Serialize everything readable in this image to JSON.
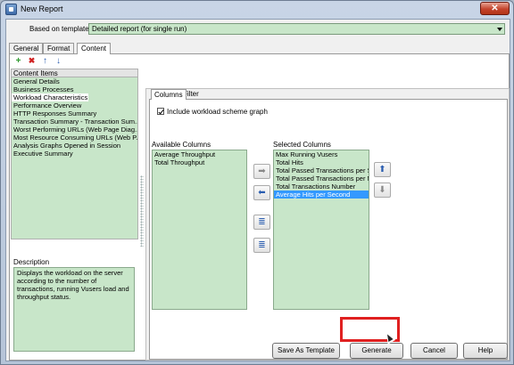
{
  "window": {
    "title": "New Report",
    "close_label": "✕"
  },
  "template": {
    "label": "Based on template",
    "value": "Detailed report (for single run)"
  },
  "tabs": [
    {
      "label": "General"
    },
    {
      "label": "Format"
    },
    {
      "label": "Content"
    }
  ],
  "toolbar": {
    "add": "+",
    "delete": "✖",
    "up": "↑",
    "down": "↓"
  },
  "content_items": {
    "header": "Content Items",
    "items": [
      "General Details",
      "Business Processes",
      "Workload Characteristics",
      "Performance Overview",
      "HTTP Responses Summary",
      "Transaction Summary - Transaction Sum...",
      "Worst Performing URLs (Web Page Diag...",
      "Most Resource Consuming URLs (Web P...",
      "Analysis Graphs Opened in Session",
      "Executive Summary"
    ],
    "selected_index": 2
  },
  "description": {
    "header": "Description",
    "text": "Displays the workload on the server according to the number of transactions, running Vusers load and throughput status."
  },
  "subtabs": [
    {
      "label": "Columns"
    },
    {
      "label": "Filter"
    }
  ],
  "columns": {
    "include_label": "Include workload scheme graph",
    "available_label": "Available Columns",
    "selected_label": "Selected Columns",
    "available": [
      "Average Throughput",
      "Total Throughput"
    ],
    "selected": [
      "Max Running Vusers",
      "Total Hits",
      "Total Passed Transactions per Se",
      "Total Passed Transactions per Mi",
      "Total Transactions Number",
      "Average Hits per Second"
    ],
    "selected_index": 5
  },
  "buttons": {
    "save_template": "Save As Template",
    "generate": "Generate",
    "cancel": "Cancel",
    "help": "Help"
  }
}
